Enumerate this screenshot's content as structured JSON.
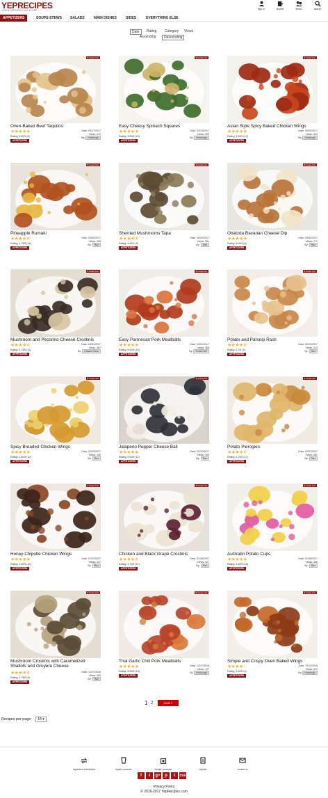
{
  "header": {
    "logo_text": "YEPRECIPES",
    "logo_tagline": "GREAT RECIPES, NO FLUFF",
    "icons": [
      {
        "name": "sign-in-icon",
        "label": "sign in"
      },
      {
        "name": "submit-icon",
        "label": "submit"
      },
      {
        "name": "share-icon",
        "label": "share"
      },
      {
        "name": "search-icon",
        "label": "search"
      }
    ]
  },
  "nav": [
    "APPETIZERS",
    "SOUPS-STEWS",
    "SALADS",
    "MAIN DISHES",
    "SIDES",
    "EVERYTHING ELSE"
  ],
  "sort": {
    "options": [
      "Date",
      "Rating",
      "Category",
      "Views"
    ],
    "selected": "Date",
    "order": [
      "Ascending",
      "Descending"
    ],
    "selected_order": "Descending"
  },
  "recipe_box_label": "recipe box",
  "date_label": "Date:",
  "views_label": "Views:",
  "by_label": "By:",
  "rating_label": "Rating:",
  "recipes": [
    {
      "title": "Oven-Baked Beef Taquitos",
      "rating": "5.00/5",
      "votes": "(6)",
      "stars": 5,
      "date": "03/17/2017",
      "views": "472",
      "user": "Hotdough",
      "category": "APPETIZERS"
    },
    {
      "title": "Easy Cheesy Spinach Squares",
      "rating": "4.93/5",
      "votes": "(16)",
      "stars": 5,
      "date": "03/13/2017",
      "views": "309",
      "user": "Hotdough",
      "category": "APPETIZERS"
    },
    {
      "title": "Asian Style Spicy Baked Chicken Wings",
      "rating": "4.89/5",
      "votes": "(19)",
      "stars": 5,
      "date": "05/02/2017",
      "views": "394",
      "user": "Hotdough",
      "category": "APPETIZERS"
    },
    {
      "title": "Pineapple Rumaki",
      "rating": "4.75/5",
      "votes": "(16)",
      "stars": 4.5,
      "date": "04/30/2017",
      "views": "308",
      "user": "Raz",
      "category": "APPETIZERS"
    },
    {
      "title": "Sherried Mushrooms Tapa",
      "rating": "4.60/5",
      "votes": "(9)",
      "stars": 4.5,
      "date": "04/30/2017",
      "views": "281",
      "user": "Raz",
      "category": "APPETIZERS"
    },
    {
      "title": "Obatzda Bavarian Cheese Dip",
      "rating": "5.00/5",
      "votes": "(6)",
      "stars": 5,
      "date": "04/30/2017",
      "views": "271",
      "user": "Raz",
      "category": "APPETIZERS"
    },
    {
      "title": "Mushroom and Pecorino Cheese Crostinis",
      "rating": "4.73/5",
      "votes": "(11)",
      "stars": 4.5,
      "date": "03/31/2017",
      "views": "387",
      "user": "Classic Pace",
      "category": "APPETIZERS"
    },
    {
      "title": "Easy Parmesan Pork Meatballs",
      "rating": "5.00/5",
      "votes": "(16)",
      "stars": 5,
      "date": "03/31/2017",
      "views": "366",
      "user": "SmileChef",
      "category": "APPETIZERS"
    },
    {
      "title": "Potato and Parsnip Rosti",
      "rating": "4.7/5",
      "votes": "(9)",
      "stars": 4.5,
      "date": "02/12/2017",
      "views": "313",
      "user": "Raz",
      "category": "APPETIZERS"
    },
    {
      "title": "Spicy Breaded Chicken Wings",
      "rating": "4.80/5",
      "votes": "(10)",
      "stars": 5,
      "date": "02/12/2017",
      "views": "340",
      "user": "Raz",
      "category": "APPETIZERS"
    },
    {
      "title": "Jalapeno Popper Cheese Ball",
      "rating": "5.00/5",
      "votes": "(12)",
      "stars": 5,
      "date": "02/12/2017",
      "views": "340",
      "user": "Raz",
      "category": "APPETIZERS"
    },
    {
      "title": "Potato Pierogies",
      "rating": "4.75/5",
      "votes": "(17)",
      "stars": 4.5,
      "date": "02/07/2017",
      "views": "352",
      "user": "Raz",
      "category": "APPETIZERS"
    },
    {
      "title": "Honey Chipotle Chicken Wings",
      "rating": "5.00/5",
      "votes": "(17)",
      "stars": 5,
      "date": "01/31/2017",
      "views": "427",
      "user": "Raz",
      "category": "APPETIZERS"
    },
    {
      "title": "Chicken and Black Grape Crostinis",
      "rating": "4.70/5",
      "votes": "(17)",
      "stars": 4.5,
      "date": "01/26/2017",
      "views": "427",
      "user": "Raz",
      "category": "APPETIZERS"
    },
    {
      "title": "AuGratin Potato Cups",
      "rating": "5.00/5",
      "votes": "(16)",
      "stars": 5,
      "date": "01/08/2017",
      "views": "368",
      "user": "Raz",
      "category": "APPETIZERS"
    },
    {
      "title": "Mushroom Crostinis with Caramelized Shallots and Gruyere Cheese",
      "rating": "4.75/5",
      "votes": "(8)",
      "stars": 4.5,
      "date": "12/27/2016",
      "views": "340",
      "user": "Raz",
      "category": "APPETIZERS"
    },
    {
      "title": "Thai Garlic Chili Pork Meatballs",
      "rating": "5.00/5",
      "votes": "(13)",
      "stars": 5,
      "date": "12/17/2016",
      "views": "727",
      "user": "Hotdough",
      "category": "APPETIZERS"
    },
    {
      "title": "Simple and Crispy Oven Baked Wings",
      "rating": "4.25/5",
      "votes": "(4)",
      "stars": 4,
      "date": "12/11/2016",
      "views": "472",
      "user": "Hotdough",
      "category": "APPETIZERS"
    }
  ],
  "pagination": {
    "pages": [
      "1",
      "2"
    ],
    "current": "1",
    "next_label": "next >"
  },
  "per_page": {
    "label": "Recipes per page:",
    "value": "18"
  },
  "footer": {
    "links": [
      {
        "name": "ingredient-substitutes-icon",
        "label": "ingredient substitutes"
      },
      {
        "name": "liquid-converter-icon",
        "label": "liquid converter"
      },
      {
        "name": "weight-converter-icon",
        "label": "weight converter"
      },
      {
        "name": "register-icon",
        "label": "register"
      },
      {
        "name": "contact-us-icon",
        "label": "contact us"
      }
    ],
    "social": [
      "f",
      "t",
      "g+",
      "p",
      "t",
      "rss"
    ],
    "privacy": "Privacy Policy",
    "copyright": "© 2016-2017 YepRecipes.com"
  },
  "colors": {
    "brand": "#8b1212",
    "star": "#f1b233",
    "next": "#cc0000"
  }
}
